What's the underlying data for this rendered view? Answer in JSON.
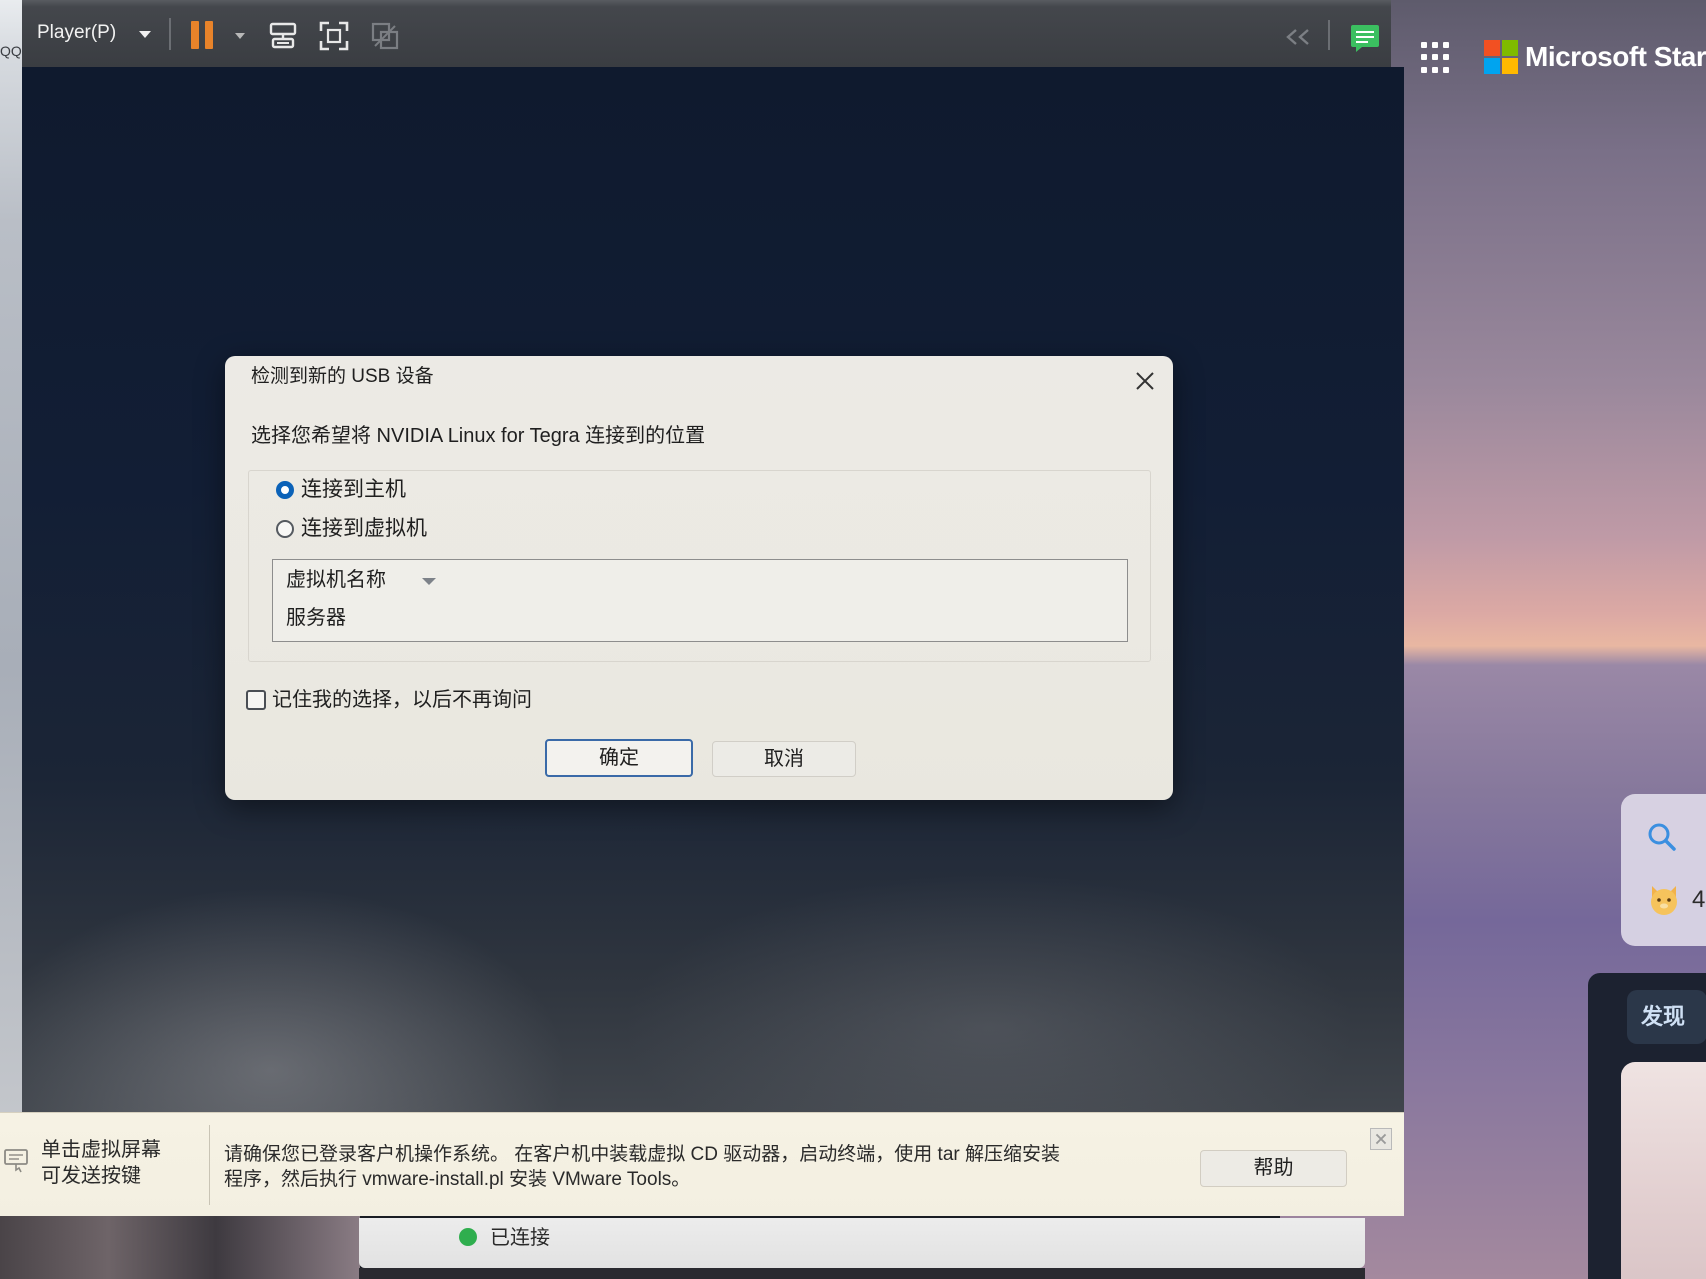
{
  "window": {
    "left_edge_label": "QQ"
  },
  "toolbar": {
    "player_menu": "Player(P)",
    "icons": [
      "chevron-down-icon",
      "pause-icon",
      "send-ctrl-alt-del-icon",
      "fullscreen-icon",
      "unity-icon",
      "collapse-icon",
      "note-icon"
    ]
  },
  "dialog": {
    "title": "检测到新的 USB 设备",
    "instruction": "选择您希望将 NVIDIA Linux for Tegra 连接到的位置",
    "options": [
      {
        "label": "连接到主机",
        "checked": true
      },
      {
        "label": "连接到虚拟机",
        "checked": false
      }
    ],
    "vm_list": {
      "header": "虚拟机名称",
      "items": [
        "服务器"
      ]
    },
    "remember": {
      "label": "记住我的选择，以后不再询问",
      "checked": false
    },
    "ok_label": "确定",
    "cancel_label": "取消"
  },
  "info_bar": {
    "hint_line1": "单击虚拟屏幕",
    "hint_line2": "可发送按键",
    "message_line1": "请确保您已登录客户机操作系统。 在客户机中装载虚拟 CD 驱动器，启动终端，使用 tar 解压缩安装",
    "message_line2": "程序，然后执行 vmware-install.pl 安装 VMware Tools。",
    "help_label": "帮助"
  },
  "status_bar": {
    "connection": "已连接"
  },
  "desktop": {
    "widget_title": "Microsoft Start",
    "widget_count": "4",
    "discover_label": "发现"
  },
  "colors": {
    "accent_blue": "#0b62b8",
    "pause_orange": "#e8832a",
    "status_green": "#2fae4e",
    "note_green": "#3bbf60",
    "ms_red": "#f25022",
    "ms_green": "#7fba00",
    "ms_blue": "#00a4ef",
    "ms_yellow": "#ffb900"
  }
}
